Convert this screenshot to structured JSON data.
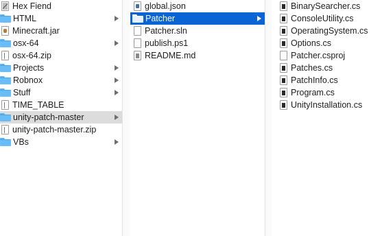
{
  "columns": [
    {
      "items": [
        {
          "label": "Hex Fiend",
          "icon": "app-icon",
          "kind": "app",
          "has_children": false
        },
        {
          "label": "HTML",
          "icon": "folder-icon",
          "kind": "folder",
          "has_children": true
        },
        {
          "label": "Minecraft.jar",
          "icon": "jar-icon",
          "kind": "java",
          "has_children": false
        },
        {
          "label": "osx-64",
          "icon": "folder-icon",
          "kind": "folder",
          "has_children": true
        },
        {
          "label": "osx-64.zip",
          "icon": "zip-icon",
          "kind": "line",
          "has_children": false
        },
        {
          "label": "Projects",
          "icon": "folder-icon",
          "kind": "folder",
          "has_children": true
        },
        {
          "label": "Robnox",
          "icon": "folder-icon",
          "kind": "folder",
          "has_children": true
        },
        {
          "label": "Stuff",
          "icon": "folder-icon",
          "kind": "folder",
          "has_children": true
        },
        {
          "label": "TIME_TABLE",
          "icon": "document-icon",
          "kind": "line",
          "has_children": false
        },
        {
          "label": "unity-patch-master",
          "icon": "folder-icon",
          "kind": "folder",
          "has_children": true,
          "selected": "gray"
        },
        {
          "label": "unity-patch-master.zip",
          "icon": "zip-icon",
          "kind": "line",
          "has_children": false
        },
        {
          "label": "VBs",
          "icon": "folder-icon",
          "kind": "folder",
          "has_children": true
        }
      ]
    },
    {
      "items": [
        {
          "label": "global.json",
          "icon": "json-file-icon",
          "kind": "json",
          "has_children": false
        },
        {
          "label": "Patcher",
          "icon": "folder-icon",
          "kind": "folder",
          "has_children": true,
          "selected": "blue"
        },
        {
          "label": "Patcher.sln",
          "icon": "document-icon",
          "kind": "blank",
          "has_children": false
        },
        {
          "label": "publish.ps1",
          "icon": "document-icon",
          "kind": "blank",
          "has_children": false
        },
        {
          "label": "README.md",
          "icon": "document-icon",
          "kind": "grayfill",
          "has_children": false
        }
      ]
    },
    {
      "items": [
        {
          "label": "BinarySearcher.cs",
          "icon": "cs-file-icon",
          "kind": "dark",
          "has_children": false
        },
        {
          "label": "ConsoleUtility.cs",
          "icon": "cs-file-icon",
          "kind": "dark",
          "has_children": false
        },
        {
          "label": "OperatingSystem.cs",
          "icon": "cs-file-icon",
          "kind": "dark",
          "has_children": false
        },
        {
          "label": "Options.cs",
          "icon": "cs-file-icon",
          "kind": "dark",
          "has_children": false
        },
        {
          "label": "Patcher.csproj",
          "icon": "document-icon",
          "kind": "blank",
          "has_children": false
        },
        {
          "label": "Patches.cs",
          "icon": "cs-file-icon",
          "kind": "dark",
          "has_children": false
        },
        {
          "label": "PatchInfo.cs",
          "icon": "cs-file-icon",
          "kind": "dark",
          "has_children": false
        },
        {
          "label": "Program.cs",
          "icon": "cs-file-icon",
          "kind": "dark",
          "has_children": false
        },
        {
          "label": "UnityInstallation.cs",
          "icon": "cs-file-icon",
          "kind": "dark",
          "has_children": false
        }
      ]
    }
  ],
  "colors": {
    "selection_active": "#0a64d6",
    "selection_inactive": "#dcdcdc",
    "folder": "#68bdf6"
  }
}
